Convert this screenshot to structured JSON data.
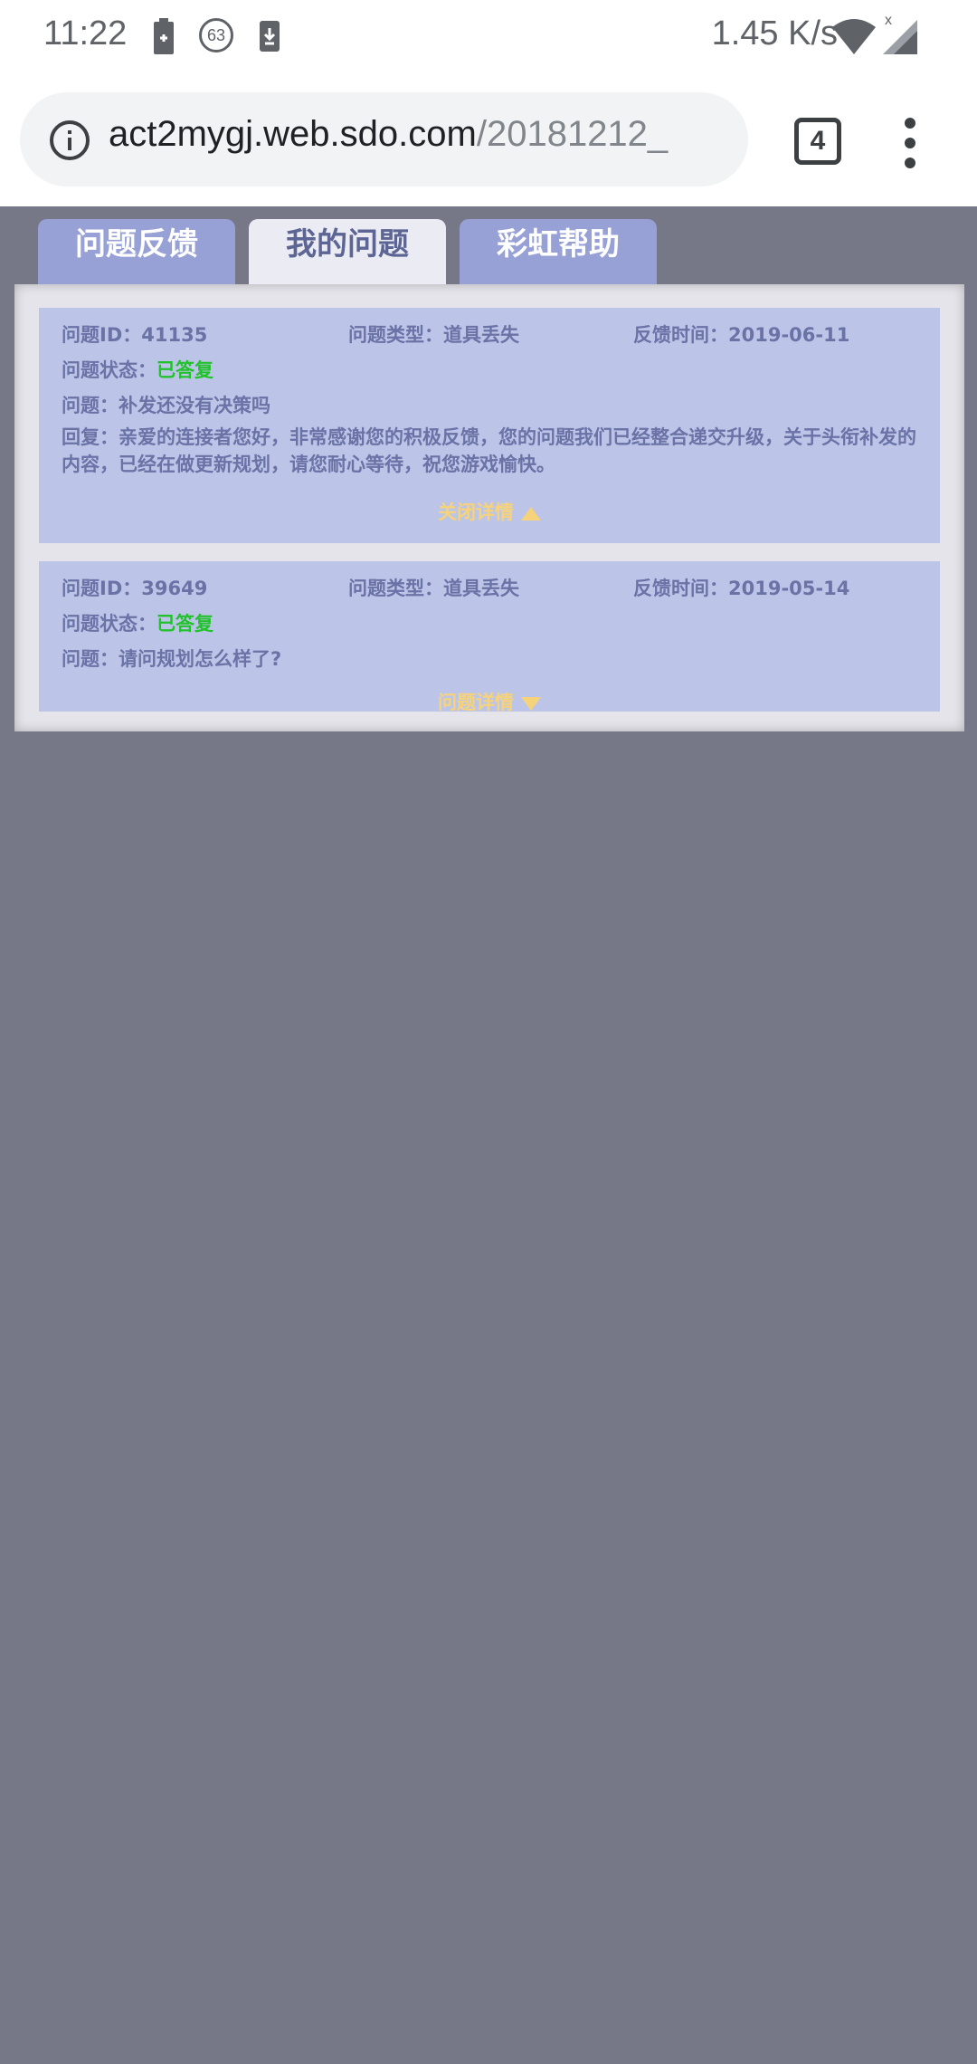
{
  "status_bar": {
    "time": "11:22",
    "notification_badge": "63",
    "network_speed": "1.45 K/s"
  },
  "browser": {
    "url_host": "act2mygj.web.sdo.com",
    "url_path": "/20181212_",
    "tab_count": "4"
  },
  "tabs": [
    {
      "label": "问题反馈",
      "active": false
    },
    {
      "label": "我的问题",
      "active": true
    },
    {
      "label": "彩虹帮助",
      "active": false
    }
  ],
  "questions": [
    {
      "id_text": "问题ID：41135",
      "type_text": "问题类型：道具丢失",
      "time_text": "反馈时间：2019-06-11",
      "status_label": "问题状态：",
      "status_value": "已答复",
      "question_text": "问题：补发还没有决策吗",
      "reply_text": "回复：亲爱的连接者您好，非常感谢您的积极反馈，您的问题我们已经整合递交升级，关于头衔补发的内容，已经在做更新规划，请您耐心等待，祝您游戏愉快。",
      "toggle_label": "关闭详情"
    },
    {
      "id_text": "问题ID：39649",
      "type_text": "问题类型：道具丢失",
      "time_text": "反馈时间：2019-05-14",
      "status_label": "问题状态：",
      "status_value": "已答复",
      "question_text": "问题：请问规划怎么样了?",
      "toggle_label": "问题详情"
    }
  ],
  "colors": {
    "page_bg": "#767888",
    "tab_bg": "#98a1d6",
    "card_bg": "#bcc5e8",
    "answered": "#22c22c",
    "toggle": "#f6d37a"
  }
}
